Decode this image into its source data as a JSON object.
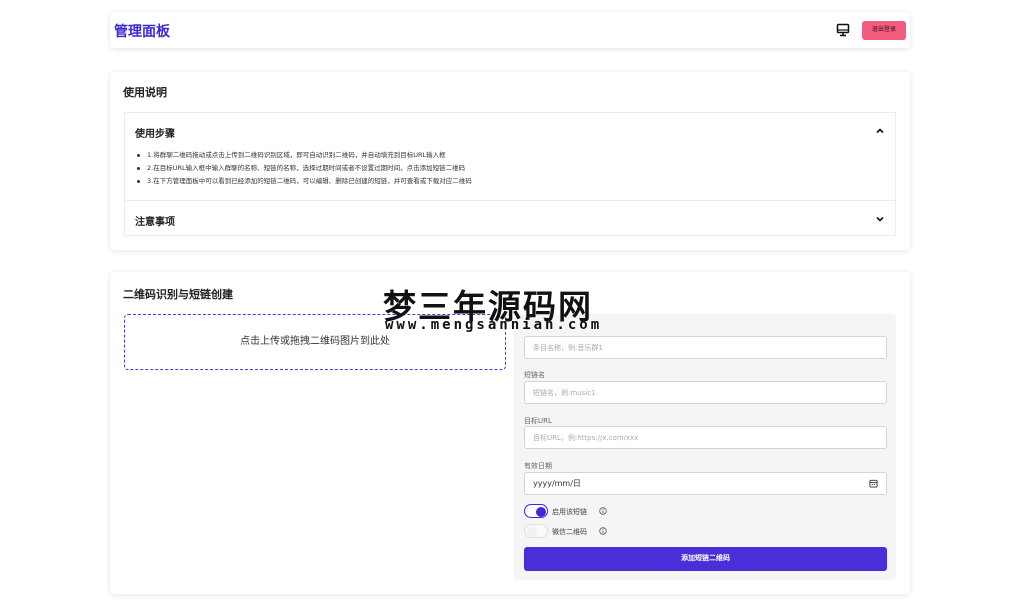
{
  "header": {
    "title": "管理面板",
    "monitor_icon": "monitor-icon",
    "logout_label": "退出登录",
    "logout_color": "#f25c7e"
  },
  "instructions": {
    "title": "使用说明",
    "steps_section": {
      "title": "使用步骤",
      "expanded": true,
      "items": [
        "1.将群聊二维码拖动或点击上传到二维码识别区域，即可自动识别二维码，并自动填充到目标URL输入框",
        "2.在目标URL输入框中输入群聊的名称、短链的名称，选择过期时间或者不设置过期时间，点击添加短链二维码",
        "3.在下方管理面板中可以看到已经添加的短链二维码，可以编辑、删除已创建的短链，并可查看或下载对应二维码"
      ]
    },
    "notes_section": {
      "title": "注意事项",
      "expanded": false
    }
  },
  "qr_section": {
    "title": "二维码识别与短链创建",
    "dropzone_text": "点击上传或拖拽二维码图片到此处",
    "form": {
      "name_placeholder": "条目名称，例:音乐群1",
      "shortlink_label": "短链名",
      "shortlink_placeholder": "短链名，例:music1",
      "target_label": "目标URL",
      "target_placeholder": "目标URL，例:https://x.com/xxx",
      "date_label": "有效日期",
      "date_value": "yyyy/mm/日",
      "toggle_enable_label": "启用该短链",
      "toggle_enable_on": true,
      "toggle_wechat_label": "微信二维码",
      "toggle_wechat_on": false,
      "submit_label": "添加短链二维码",
      "accent_color": "#4a2fd9"
    }
  },
  "watermark": {
    "title": "梦三年源码网",
    "url": "www.mengsannian.com"
  }
}
